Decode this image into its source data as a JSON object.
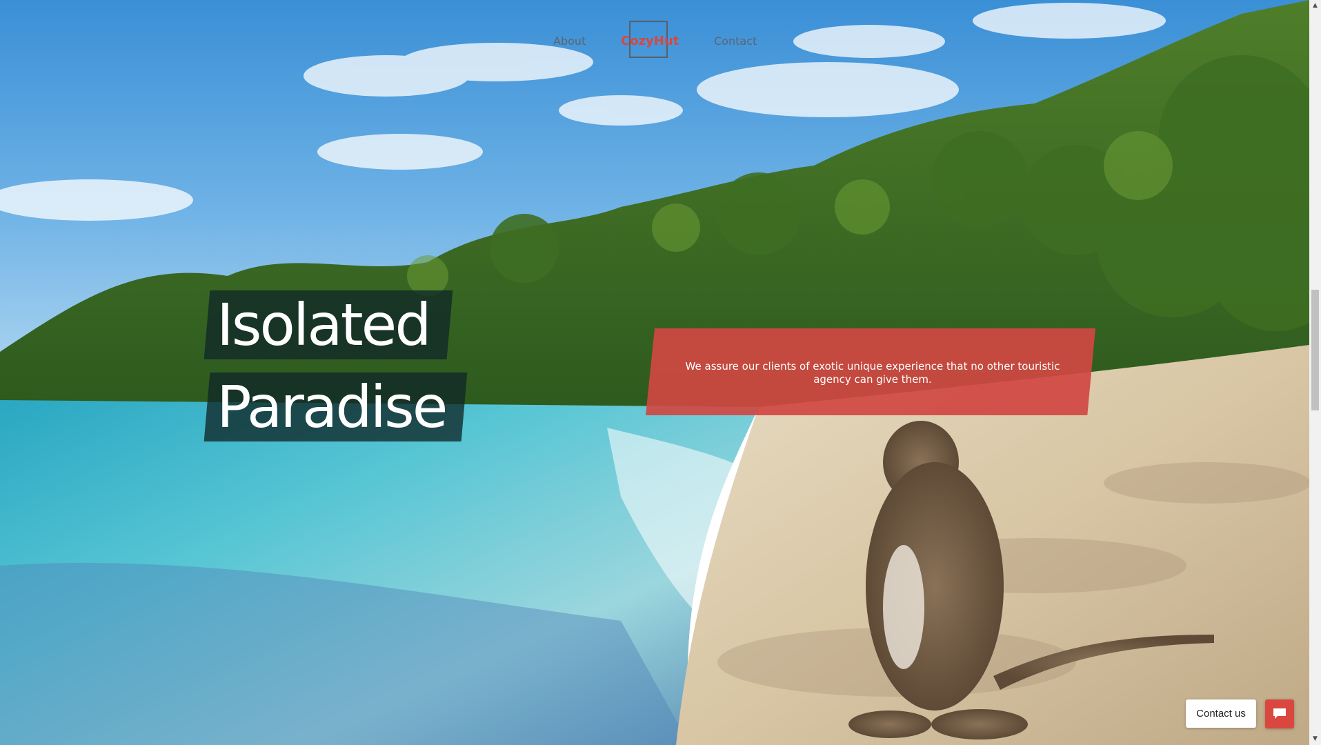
{
  "nav": {
    "about_label": "About",
    "brand_label": "CozyHut",
    "contact_label": "Contact"
  },
  "hero": {
    "headline_line1": "Isolated",
    "headline_line2": "Paradise",
    "tagline": "We assure our clients of exotic unique experience that no other touristic agency can give them."
  },
  "contact_widget": {
    "label": "Contact us",
    "icon": "chat-bubble-icon"
  },
  "colors": {
    "accent": "#d9473f",
    "headline_bg": "#0f2828"
  }
}
